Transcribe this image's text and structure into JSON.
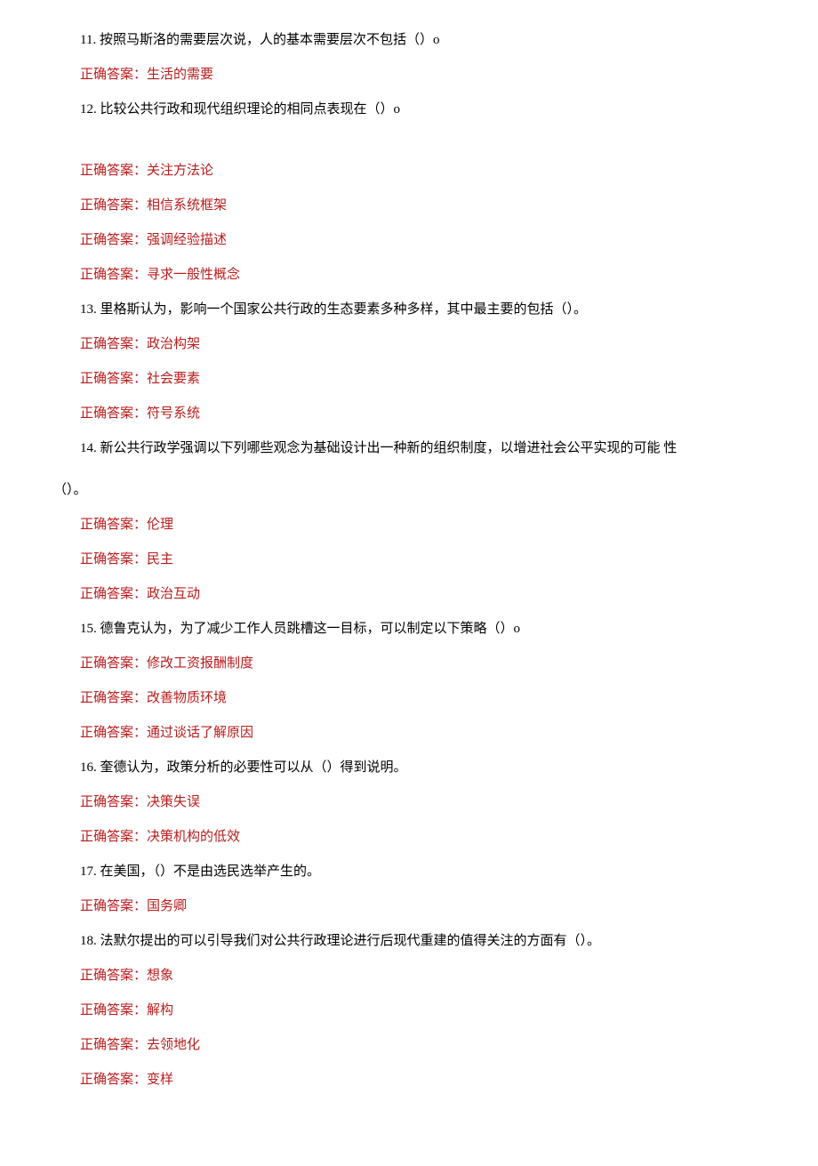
{
  "answer_prefix": "正确答案：",
  "questions": [
    {
      "number": "11.",
      "text": "按照马斯洛的需要层次说，人的基本需要层次不包括（）o",
      "answers": [
        "生活的需要"
      ]
    },
    {
      "number": "12.",
      "text": "比较公共行政和现代组织理论的相同点表现在（）o",
      "spacer_after_question": true,
      "answers": [
        "关注方法论",
        "相信系统框架",
        "强调经验描述",
        "寻求一般性概念"
      ]
    },
    {
      "number": "13.",
      "text": " 里格斯认为，影响一个国家公共行政的生态要素多种多样，其中最主要的包括（）。",
      "answers": [
        "政治构架",
        "社会要素",
        "符号系统"
      ]
    },
    {
      "number": "14.",
      "text": " 新公共行政学强调以下列哪些观念为基础设计出一种新的组织制度，以增进社会公平实现的可能  性",
      "text_line2": "（）。",
      "multiline": true,
      "answers": [
        "伦理",
        "民主",
        "政治互动"
      ]
    },
    {
      "number": "15.",
      "text": " 德鲁克认为，为了减少工作人员跳槽这一目标，可以制定以下策略（）o",
      "answers": [
        "修改工资报酬制度",
        "改善物质环境",
        "通过谈话了解原因"
      ]
    },
    {
      "number": "16.",
      "text": " 奎德认为，政策分析的必要性可以从（）得到说明。",
      "answers": [
        "决策失误",
        "决策机构的低效"
      ]
    },
    {
      "number": "17.",
      "text": " 在美国，（）不是由选民选举产生的。",
      "answers": [
        "国务卿"
      ]
    },
    {
      "number": "18.",
      "text": " 法默尔提出的可以引导我们对公共行政理论进行后现代重建的值得关注的方面有（）。",
      "answers": [
        "想象",
        "解构",
        "去领地化",
        "变样"
      ]
    }
  ]
}
